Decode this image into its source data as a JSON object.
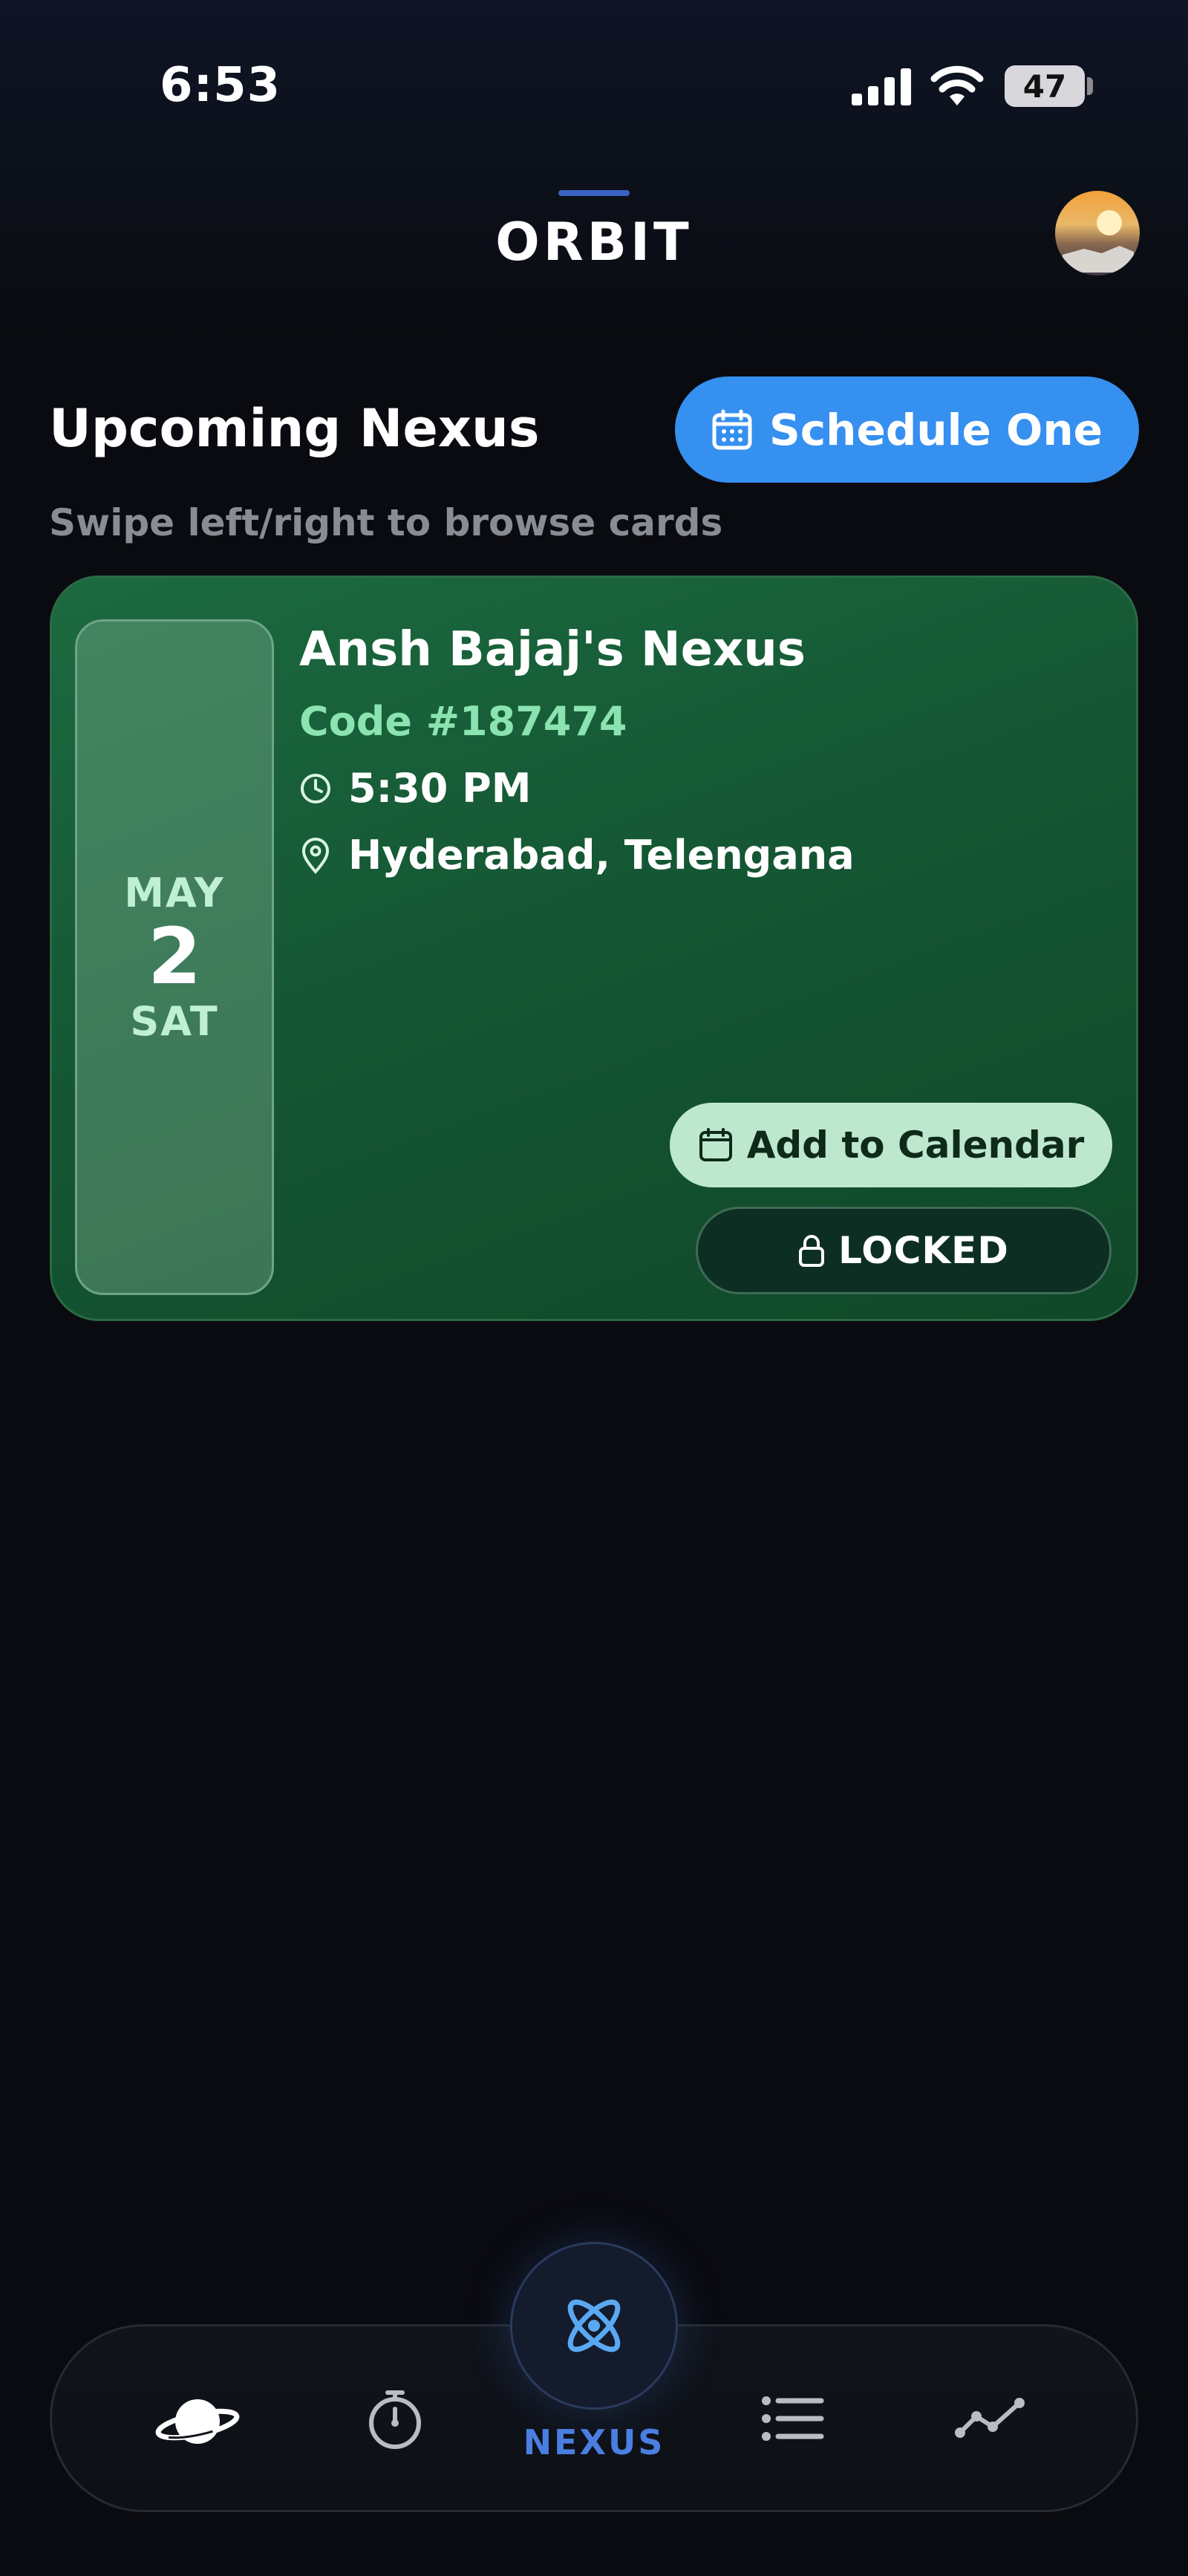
{
  "status_bar": {
    "time": "6:53",
    "battery_level": "47"
  },
  "header": {
    "title": "ORBIT"
  },
  "upcoming": {
    "title": "Upcoming Nexus",
    "subtitle": "Swipe left/right to browse cards",
    "schedule_button": "Schedule One"
  },
  "card": {
    "month": "MAY",
    "day": "2",
    "weekday": "SAT",
    "name": "Ansh Bajaj's Nexus",
    "code": "Code #187474",
    "time": "5:30 PM",
    "location": "Hyderabad, Telengana",
    "add_calendar_button": "Add to Calendar",
    "locked_button": "LOCKED"
  },
  "bottom_nav": {
    "items": [
      {
        "icon": "planet-icon"
      },
      {
        "icon": "stopwatch-icon"
      },
      {
        "icon": "atom-icon",
        "label": "NEXUS",
        "active": true
      },
      {
        "icon": "list-icon"
      },
      {
        "icon": "trend-icon"
      }
    ]
  },
  "colors": {
    "background": "#0a0b10",
    "accent_blue": "#3590f0",
    "card_green": "#155734",
    "code_green": "#8be3b0",
    "nav_active": "#4a7ee0"
  }
}
